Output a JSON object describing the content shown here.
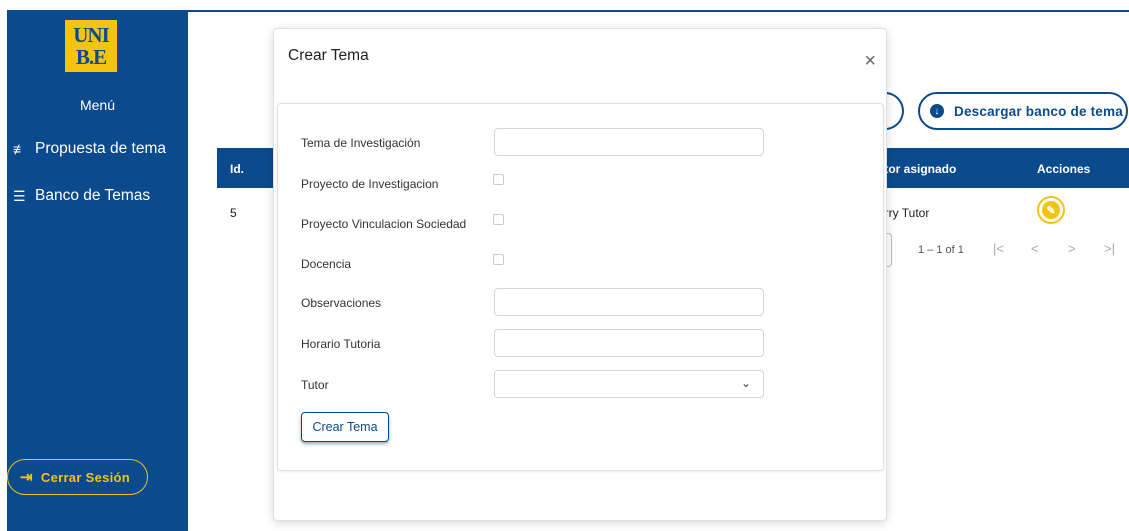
{
  "sidebar": {
    "logo_line1": "UNI",
    "logo_line2": "B.E",
    "menu_title": "Menú",
    "items": [
      {
        "label": "Propuesta de tema",
        "icon": "playlist-add-icon"
      },
      {
        "label": "Banco de Temas",
        "icon": "list-icon"
      }
    ],
    "logout_label": "Cerrar Sesión"
  },
  "toolbar": {
    "download_label": "Descargar banco de tema"
  },
  "table": {
    "headers": [
      "Id.",
      "Tutor asignado",
      "Acciones"
    ],
    "headers_visible": [
      "Id.",
      "utor asignado",
      "Acciones"
    ],
    "rows": [
      {
        "id": "5",
        "tutor": "arry Tutor"
      }
    ]
  },
  "pagination": {
    "range": "1 – 1 of 1"
  },
  "modal": {
    "title": "Crear Tema",
    "close": "×",
    "fields": {
      "tema": {
        "label": "Tema de Investigación",
        "value": ""
      },
      "proyecto_inv": {
        "label": "Proyecto de Investigacion",
        "checked": false
      },
      "proyecto_vinc": {
        "label": "Proyecto Vinculacion Sociedad",
        "checked": false
      },
      "docencia": {
        "label": "Docencia",
        "checked": false
      },
      "observaciones": {
        "label": "Observaciones",
        "value": ""
      },
      "horario": {
        "label": "Horario Tutoria",
        "value": ""
      },
      "tutor": {
        "label": "Tutor",
        "value": ""
      }
    },
    "submit_label": "Crear Tema"
  },
  "colors": {
    "primary": "#0b4a8c",
    "accent": "#f2c30f"
  }
}
